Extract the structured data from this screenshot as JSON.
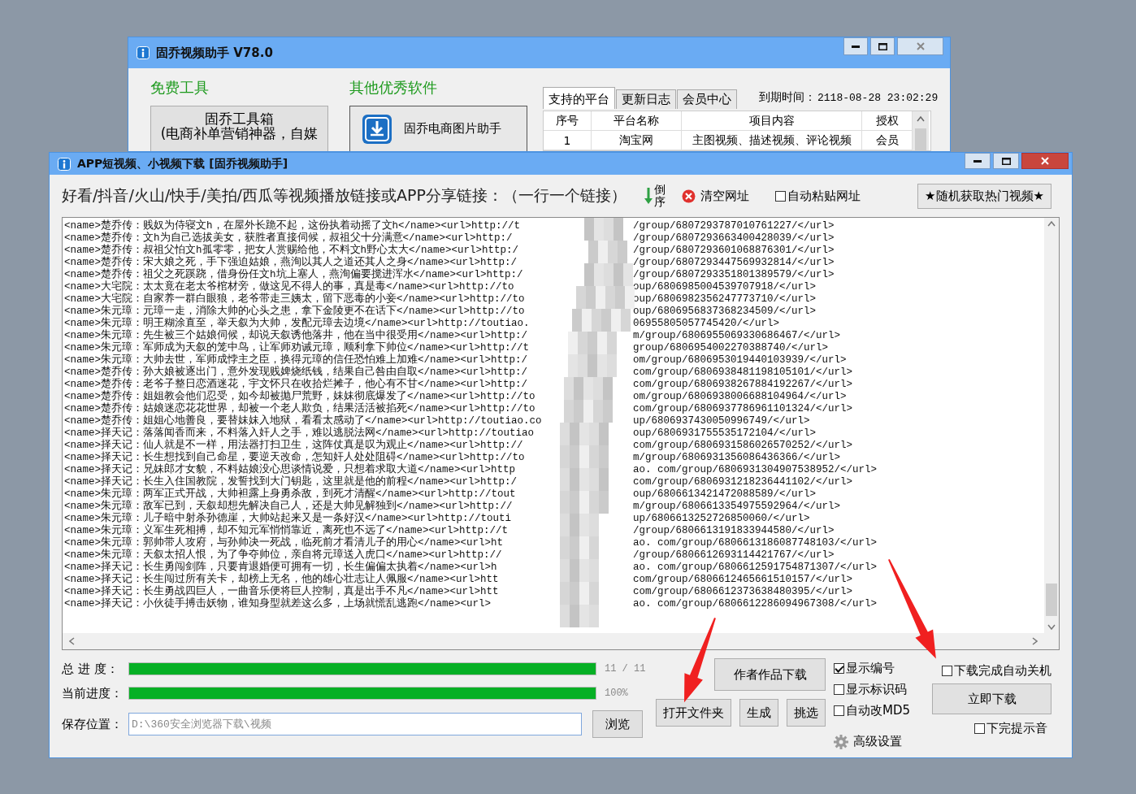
{
  "back_window": {
    "title": "固乔视频助手 V78.0",
    "free_tools": {
      "heading": "免费工具",
      "button_lines": [
        "固乔工具箱",
        "(电商补单营销神器，自媒"
      ]
    },
    "other_software": {
      "heading": "其他优秀软件",
      "button": "固乔电商图片助手"
    },
    "tabs": [
      {
        "label": "支持的平台",
        "selected": true
      },
      {
        "label": "更新日志",
        "selected": false
      },
      {
        "label": "会员中心",
        "selected": false
      }
    ],
    "expiry_label": "到期时间：",
    "expiry_value": "2118-08-28 23:02:29",
    "table": {
      "columns": [
        "序号",
        "平台名称",
        "项目内容",
        "授权"
      ],
      "rows": [
        [
          "1",
          "淘宝网",
          "主图视频、描述视频、评论视频",
          "会员"
        ]
      ]
    }
  },
  "main_window": {
    "title": "APP短视频、小视频下载 [固乔视频助手]",
    "instruction": "好看/抖音/火山/快手/美拍/西瓜等视频播放链接或APP分享链接：（一行一个链接）",
    "reverse_button": "倒序",
    "clear_button": "清空网址",
    "auto_paste": {
      "label": "自动粘贴网址",
      "checked": false
    },
    "random_button": "★随机获取热门视频★",
    "links": [
      {
        "left": "<name>楚乔传：贱奴为侍寝文h，在屋外长跪不起，这份执着动摇了文h</name><url>http://t",
        "right": "/group/6807293787010761227/</url>"
      },
      {
        "left": "<name>楚乔传：文h为自己选拔美女，获胜者直接伺候，叔祖父十分满意</name><url>http:/",
        "right": "/group/6807293663400428039/</url>"
      },
      {
        "left": "<name>楚乔传：叔祖父怕文h孤零零，把女人赏赐给他，不料文h野心太大</name><url>http:/",
        "right": "/group/6807293601068876301/</url>"
      },
      {
        "left": "<name>楚乔传：宋大娘之死，手下强迫姑娘，燕洵以其人之道还其人之身</name><url>http:/",
        "right": "/group/6807293447569932814/</url>"
      },
      {
        "left": "<name>楚乔传：祖父之死蹊跷，借身份任文h坑上塞人，燕洵偏要搅进浑水</name><url>http:/",
        "right": "/group/6807293351801389579/</url>"
      },
      {
        "left": "<name>大宅院：太太竟在老太爷棺材旁，做这见不得人的事，真是毒</name><url>http://to",
        "right": "oup/6806985004539707918/</url>"
      },
      {
        "left": "<name>大宅院：自家养一群白眼狼，老爷带走三姨太，留下恶毒的小妾</name><url>http://to",
        "right": "oup/6806982356247773710/</url>"
      },
      {
        "left": "<name>朱元璋：元璋一走，消除大帅的心头之患，拿下金陵更不在话下</name><url>http://to",
        "right": "oup/6806956837368234509/</url>"
      },
      {
        "left": "<name>朱元璋：明王糊涂直至，举天叙为大帅，发配元璋去边境</name><url>http://toutiao.",
        "right": "06955805057745420/</url>"
      },
      {
        "left": "<name>朱元璋：先生被三个姑娘伺候，却说天叙诱他落井，他在当中很受用</name><url>http:/",
        "right": "m/group/6806955069330686467/</url>"
      },
      {
        "left": "<name>朱元璋：军师成为天叙的笼中鸟，让军师劝诫元璋，顺利拿下帅位</name><url>http://t",
        "right": "group/6806954002270388740/</url>"
      },
      {
        "left": "<name>朱元璋：大帅去世，军师成悖主之臣，换得元璋的信任恐怕难上加难</name><url>http:/",
        "right": "om/group/6806953019440103939/</url>"
      },
      {
        "left": "<name>楚乔传：孙大娘被逐出门，意外发现贱婢烧纸钱，结果自己咎由自取</name><url>http:/",
        "right": "com/group/6806938481198105101/</url>"
      },
      {
        "left": "<name>楚乔传：老爷子整日恋酒迷花，宇文怀只在收拾烂摊子，他心有不甘</name><url>http:/",
        "right": "com/group/6806938267884192267/</url>"
      },
      {
        "left": "<name>楚乔传：姐姐教会他们忍受，如今却被抛尸荒野，妹妹彻底爆发了</name><url>http://to",
        "right": "om/group/6806938006688104964/</url>"
      },
      {
        "left": "<name>楚乔传：姑娘迷恋花花世界，却被一个老人欺负，结果活活被掐死</name><url>http://to",
        "right": "com/group/6806937786961101324/</url>"
      },
      {
        "left": "<name>楚乔传：姐姐心地善良，要替妹妹入地狱，看看太感动了</name><url>http://toutiao.co",
        "right": "up/6806937430050996749/</url>"
      },
      {
        "left": "<name>择天记：落落闻香而来，不料落入奸人之手，难以逃脱法网</name><url>http://toutiao",
        "right": "oup/6806931755535172104/</url>"
      },
      {
        "left": "<name>择天记：仙人就是不一样，用法器打扫卫生，这阵仗真是叹为观止</name><url>http://",
        "right": "com/group/6806931586026570252/</url>"
      },
      {
        "left": "<name>择天记：长生想找到自己命星，要逆天改命，怎知奸人处处阻碍</name><url>http://to",
        "right": "m/group/6806931356086436366/</url>"
      },
      {
        "left": "<name>择天记：兄妹郎才女貌，不料姑娘没心思谈情说爱，只想着求取大道</name><url>http",
        "right": "ao. com/group/6806931304907538952/</url>"
      },
      {
        "left": "<name>择天记：长生入住国教院，发誓找到大门钥匙，这里就是他的前程</name><url>http:/",
        "right": "com/group/6806931218236441102/</url>"
      },
      {
        "left": "<name>朱元璋：两军正式开战，大帅袒露上身勇杀敌，到死才清醒</name><url>http://tout",
        "right": "oup/6806613421472088589/</url>"
      },
      {
        "left": "<name>朱元璋：敌军已到，天叙却想先解决自己人，还是大帅见解独到</name><url>http://",
        "right": "m/group/6806613354975592964/</url>"
      },
      {
        "left": "<name>朱元璋：儿子暗中射杀孙德崖，大帅站起来又是一条好汉</name><url>http://touti",
        "right": "up/6806613252726850060/</url>"
      },
      {
        "left": "<name>朱元璋：义军生死相搏，却不知元军悄悄靠近，离死也不远了</name><url>http://t",
        "right": "/group/6806613191833944580/</url>"
      },
      {
        "left": "<name>朱元璋：郭帅带人攻府，与孙帅决一死战，临死前才看清儿子的用心</name><url>ht",
        "right": "ao. com/group/6806613186087748103/</url>"
      },
      {
        "left": "<name>朱元璋：天叙太招人恨，为了争夺帅位，亲自将元璋送入虎口</name><url>http://",
        "right": "/group/6806612693114421767/</url>"
      },
      {
        "left": "<name>择天记：长生勇闯剑阵，只要肯退婚便可拥有一切，长生偏偏太执着</name><url>h",
        "right": "ao. com/group/6806612591754871307/</url>"
      },
      {
        "left": "<name>择天记：长生闯过所有关卡，却榜上无名，他的雄心壮志让人佩服</name><url>htt",
        "right": "com/group/6806612465661510157/</url>"
      },
      {
        "left": "<name>择天记：长生勇战四巨人，一曲音乐便将巨人控制，真是出手不凡</name><url>htt",
        "right": "com/group/6806612373638480395/</url>"
      },
      {
        "left": "<name>择天记：小伙徒手搏击妖物，谁知身型就差这么多，上场就慌乱逃跑</name><url>",
        "right": "ao. com/group/6806612286094967308/</url>"
      }
    ],
    "progress": [
      {
        "label": "总 进 度：",
        "level": 1,
        "reading": "11 / 11"
      },
      {
        "label": "当前进度：",
        "level": 1,
        "reading": "100%"
      }
    ],
    "save_location": {
      "label": "保存位置：",
      "value": "D:\\360安全浏览器下载\\视频"
    },
    "browse_button": "浏览",
    "author_button": "作者作品下载",
    "action_buttons": [
      "打开文件夹",
      "生成",
      "挑选"
    ],
    "options": [
      {
        "label": "显示编号",
        "checked": true
      },
      {
        "label": "显示标识码",
        "checked": false
      },
      {
        "label": "自动改MD5",
        "checked": false
      }
    ],
    "advanced_settings": "高级设置",
    "shutdown": {
      "label": "下载完成自动关机",
      "checked": false
    },
    "download_button": "立即下载",
    "sound": {
      "label": "下完提示音",
      "checked": false
    }
  }
}
